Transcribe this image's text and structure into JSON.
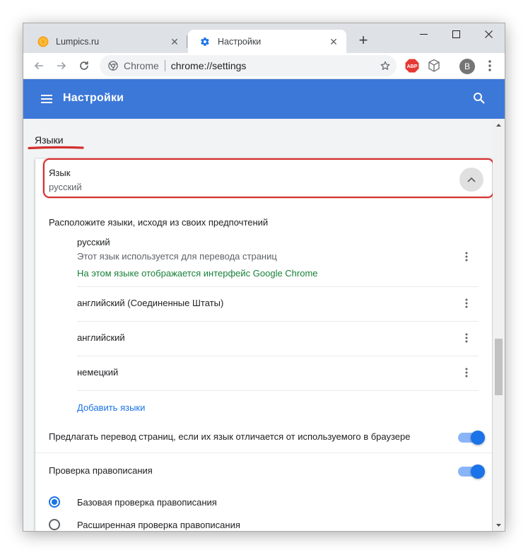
{
  "tabs": [
    {
      "title": "Lumpics.ru",
      "icon": "orange-slice-icon",
      "active": false
    },
    {
      "title": "Настройки",
      "icon": "gear-icon",
      "active": true
    }
  ],
  "toolbar": {
    "origin": "Chrome",
    "url": "chrome://settings",
    "profile_initial": "B"
  },
  "header": {
    "title": "Настройки"
  },
  "section": {
    "title": "Языки"
  },
  "language_expander": {
    "label": "Язык",
    "value": "русский"
  },
  "arrange_text": "Расположите языки, исходя из своих предпочтений",
  "languages": [
    {
      "name": "русский",
      "note": "Этот язык используется для перевода страниц",
      "note_green": "На этом языке отображается интерфейс Google Chrome"
    },
    {
      "name": "английский (Соединенные Штаты)"
    },
    {
      "name": "английский"
    },
    {
      "name": "немецкий"
    }
  ],
  "add_languages": "Добавить языки",
  "translate_toggle": {
    "label": "Предлагать перевод страниц, если их язык отличается от используемого в браузере",
    "on": true
  },
  "spellcheck_toggle": {
    "label": "Проверка правописания",
    "on": true
  },
  "spellcheck_options": [
    {
      "label": "Базовая проверка правописания",
      "checked": true
    },
    {
      "label": "Расширенная проверка правописания",
      "checked": false
    }
  ],
  "colors": {
    "header": "#3c78d8",
    "accent": "#1a73e8",
    "highlight": "#d32f2f",
    "green_note": "#188038"
  }
}
